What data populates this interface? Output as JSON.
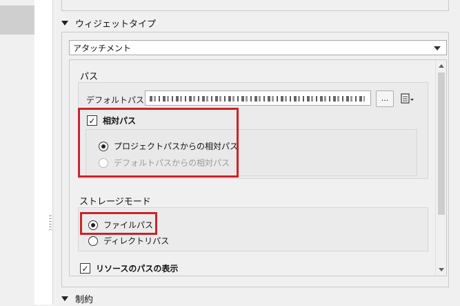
{
  "sections": {
    "widget_type_title": "ウィジェットタイプ",
    "constraints_title": "制約"
  },
  "widget_combo": {
    "value": "アタッチメント"
  },
  "path_group": {
    "title": "パス",
    "default_path_label": "デフォルトパス",
    "browse_label": "...",
    "relative_path_label": "相対パス",
    "relative_path_checked": true,
    "radio_project": "プロジェクトパスからの相対パス",
    "radio_default": "デフォルトパスからの相対パス",
    "radio_project_selected": true
  },
  "storage_group": {
    "title": "ストレージモード",
    "radio_file": "ファイルパス",
    "radio_directory": "ディレクトリパス",
    "radio_file_selected": true
  },
  "show_resource_path": {
    "label": "リソースのパスの表示",
    "checked": true
  },
  "colors": {
    "highlight": "#cc2229",
    "panel_bg": "#f0f0f0"
  }
}
